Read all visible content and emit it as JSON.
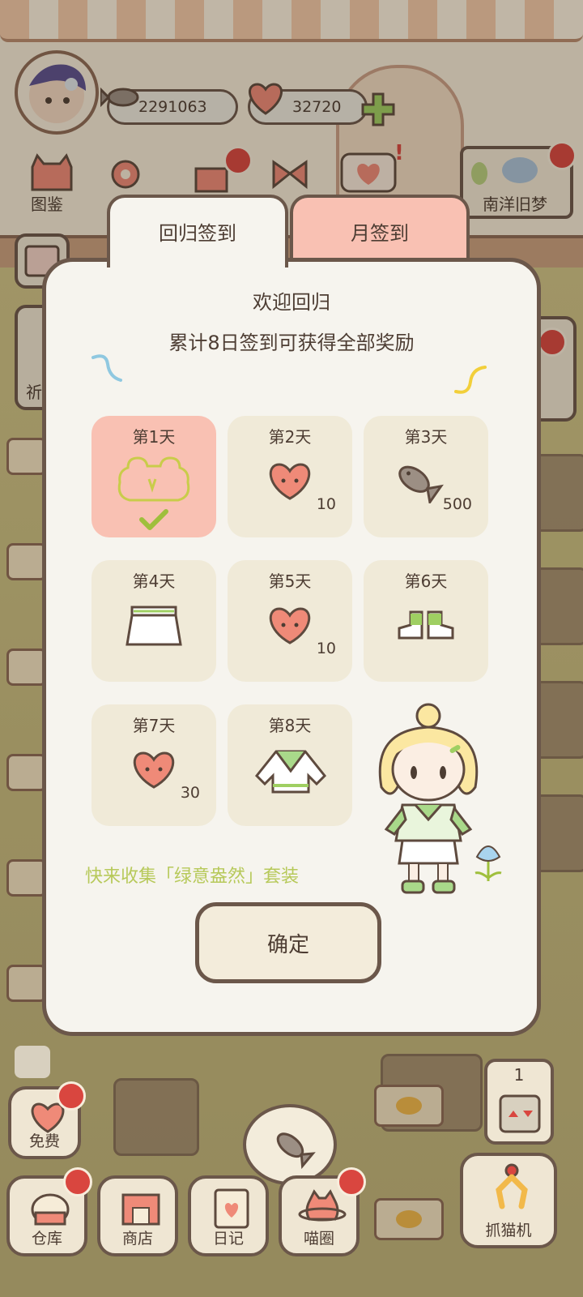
{
  "hud": {
    "fish_count": "2291063",
    "heart_count": "32720",
    "top_left_button_label": "图鉴",
    "top_right_button_label": "南洋旧梦",
    "side_button_label_partial": "祈"
  },
  "dialog": {
    "tabs": [
      {
        "label": "回归签到",
        "active": true
      },
      {
        "label": "月签到",
        "active": false
      }
    ],
    "title": "欢迎回归",
    "subtitle": "累计8日签到可获得全部奖励",
    "days": [
      {
        "label": "第1天",
        "reward": "frog-hat-icon",
        "qty": "",
        "claimed": true
      },
      {
        "label": "第2天",
        "reward": "heart-currency-icon",
        "qty": "10",
        "claimed": false
      },
      {
        "label": "第3天",
        "reward": "fish-currency-icon",
        "qty": "500",
        "claimed": false
      },
      {
        "label": "第4天",
        "reward": "skirt-icon",
        "qty": "",
        "claimed": false
      },
      {
        "label": "第5天",
        "reward": "heart-currency-icon",
        "qty": "10",
        "claimed": false
      },
      {
        "label": "第6天",
        "reward": "sneakers-icon",
        "qty": "",
        "claimed": false
      },
      {
        "label": "第7天",
        "reward": "heart-currency-icon",
        "qty": "30",
        "claimed": false
      },
      {
        "label": "第8天",
        "reward": "sweater-icon",
        "qty": "",
        "claimed": false
      }
    ],
    "collect_text": "快来收集「绿意盎然」套装",
    "confirm_label": "确定"
  },
  "bottom": {
    "free_label": "免费",
    "warehouse_label": "仓库",
    "shop_label": "商店",
    "diary_label": "日记",
    "circle_label": "喵圈",
    "claw_label": "抓猫机",
    "claw_count": "1"
  },
  "colors": {
    "accent_pink": "#f9c1b3",
    "panel": "#f6f4ee",
    "outline": "#6b574a",
    "collect_green": "#b7c95a"
  }
}
